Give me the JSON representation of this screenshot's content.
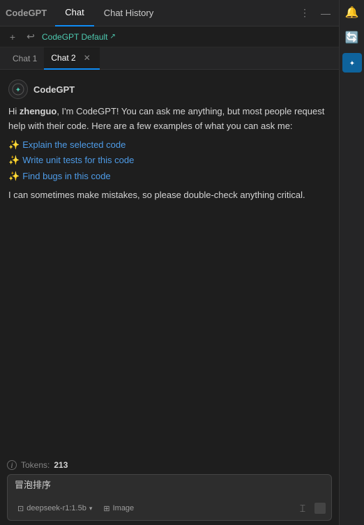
{
  "app": {
    "name": "CodeGPT"
  },
  "header": {
    "tabs": [
      {
        "label": "Chat",
        "active": true
      },
      {
        "label": "Chat History",
        "active": false
      }
    ],
    "actions": [
      "⋮",
      "—"
    ]
  },
  "toolbar": {
    "buttons": [
      "+",
      "↩"
    ],
    "model_name": "CodeGPT Default",
    "model_arrow": "↗"
  },
  "chat_tabs": [
    {
      "label": "Chat 1",
      "active": false,
      "closeable": false
    },
    {
      "label": "Chat 2",
      "active": true,
      "closeable": true
    }
  ],
  "bot": {
    "name": "CodeGPT",
    "avatar_emoji": "🤖"
  },
  "message": {
    "greeting_prefix": "Hi ",
    "username": "zhenguo",
    "greeting_suffix": ", I'm CodeGPT! You can ask me anything, but most people request help with their code. Here are a few examples of what you can ask me:",
    "suggestions": [
      "Explain the selected code",
      "Write unit tests for this code",
      "Find bugs in this code"
    ],
    "footer": "I can sometimes make mistakes, so please double-check anything critical."
  },
  "bottom": {
    "tokens_label": "Tokens:",
    "tokens_value": "213",
    "input_value": "冒泡排序",
    "model_label": "deepseek-r1:1.5b",
    "image_label": "Image"
  },
  "sidebar": {
    "icons": [
      "🔔",
      "🔄",
      "🤖"
    ]
  }
}
